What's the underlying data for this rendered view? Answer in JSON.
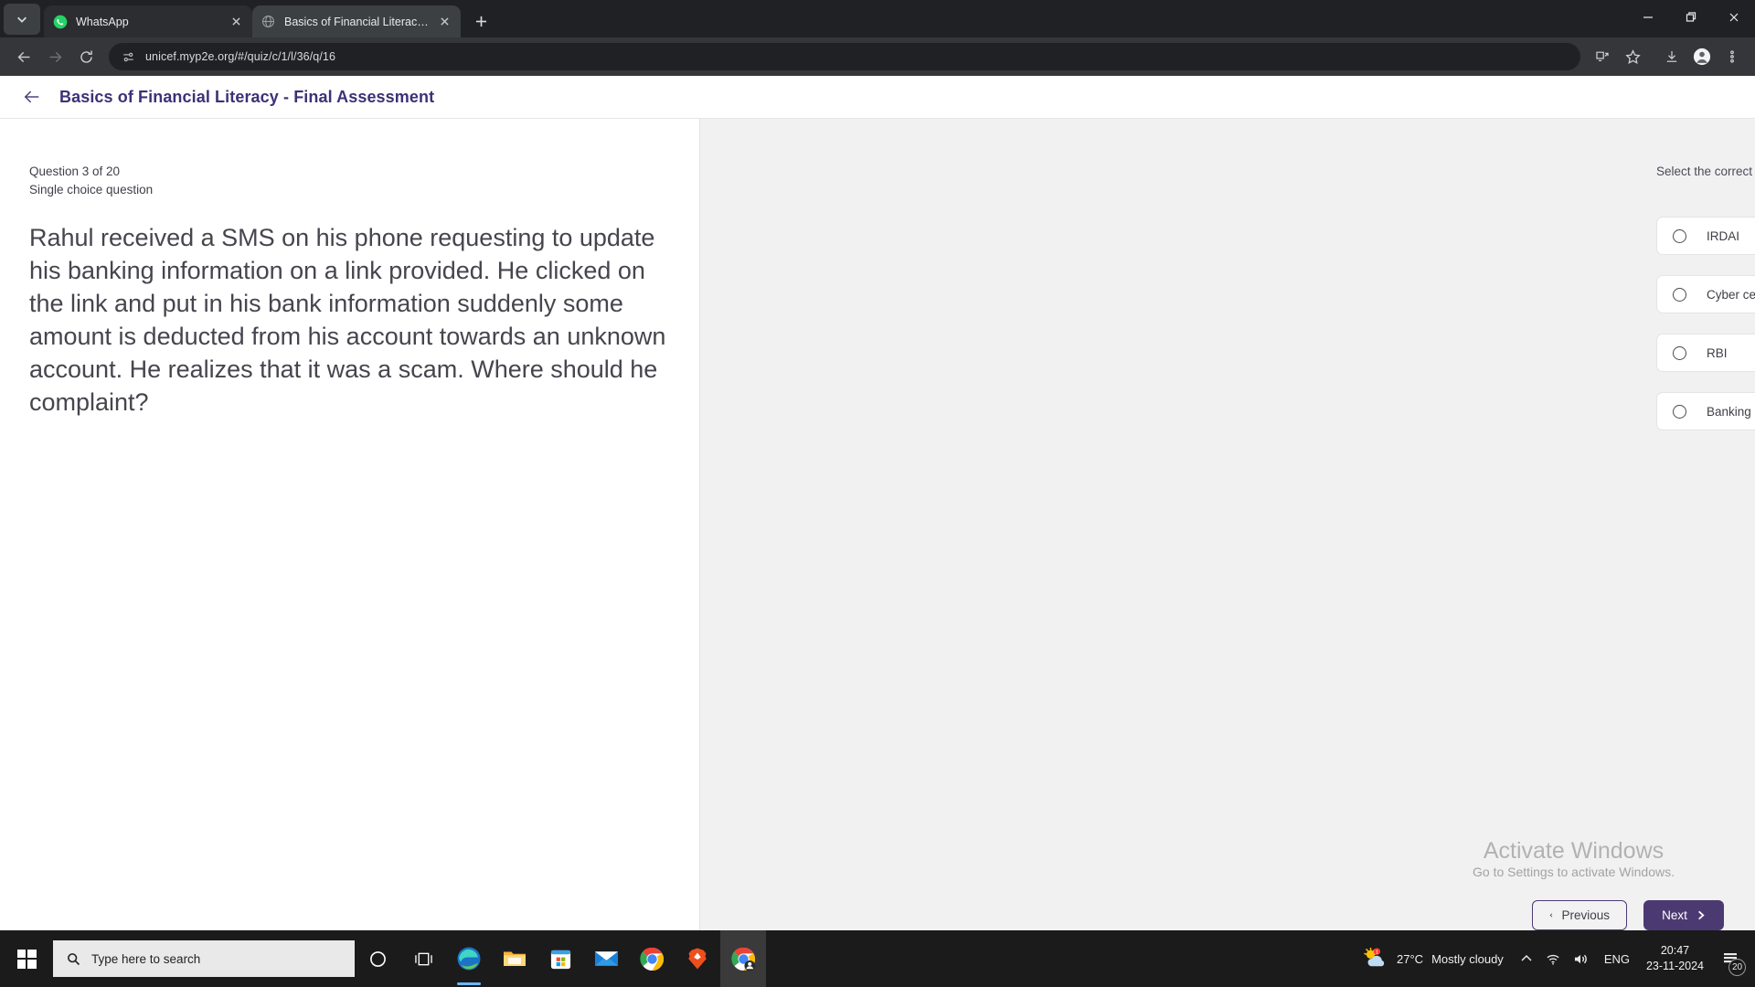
{
  "browser": {
    "tabs": [
      {
        "title": "WhatsApp",
        "favicon": "whatsapp-icon",
        "active": false
      },
      {
        "title": "Basics of Financial Literacy - Fin",
        "favicon": "globe-icon",
        "active": true
      }
    ],
    "new_tab_label": "+",
    "url": "unicef.myp2e.org/#/quiz/c/1/l/36/q/16",
    "toolbar_icons": [
      "install-icon",
      "bookmark-star-icon",
      "download-icon",
      "profile-icon",
      "more-menu-icon"
    ],
    "nav_icons": [
      "back-icon",
      "forward-icon",
      "reload-icon"
    ],
    "window_controls": [
      "minimize-icon",
      "maximize-icon",
      "close-icon"
    ]
  },
  "app": {
    "title": "Basics of Financial Literacy - Final Assessment",
    "back_label": "back-arrow-icon",
    "accent_color": "#3b3277",
    "button_color": "#4b3a72"
  },
  "question": {
    "counter": "Question 3 of 20",
    "type": "Single choice question",
    "text": "Rahul received a SMS on his phone requesting to update his banking information on a link provided. He clicked on the link and put in his bank information suddenly some amount is deducted from his account towards an unknown account. He realizes that it was a scam. Where should he complaint?"
  },
  "answers": {
    "prompt": "Select the correct answer",
    "options": [
      {
        "label": "IRDAI",
        "selected": false
      },
      {
        "label": "Cyber cell",
        "selected": false
      },
      {
        "label": "RBI",
        "selected": false
      },
      {
        "label": "Banking correspondent",
        "selected": false
      }
    ]
  },
  "navigation": {
    "previous_label": "Previous",
    "next_label": "Next"
  },
  "watermark": {
    "line1": "Activate Windows",
    "line2": "Go to Settings to activate Windows."
  },
  "taskbar": {
    "search_placeholder": "Type here to search",
    "apps": [
      "cortana-icon",
      "task-view-icon",
      "edge-icon",
      "file-explorer-icon",
      "microsoft-store-icon",
      "mail-icon",
      "chrome-icon",
      "brave-icon",
      "chrome-active-icon"
    ],
    "tray": {
      "temperature": "27°C",
      "weather": "Mostly cloudy",
      "language": "ENG",
      "time": "20:47",
      "date": "23-11-2024",
      "notification_count": "20"
    }
  }
}
